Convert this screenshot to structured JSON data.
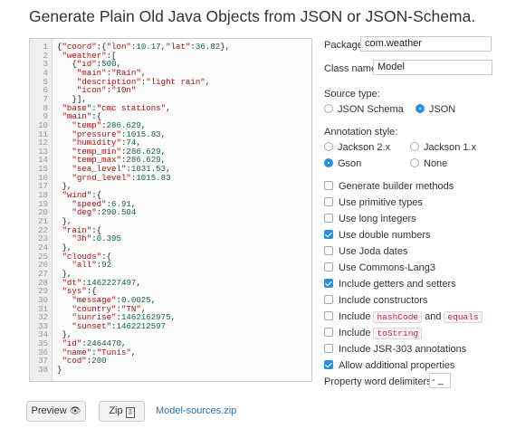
{
  "page": {
    "title": "Generate Plain Old Java Objects from JSON or JSON-Schema."
  },
  "editor": {
    "lines": [
      [
        [
          "p",
          "{"
        ],
        [
          "k",
          "\"coord\""
        ],
        [
          "p",
          ":{"
        ],
        [
          "k",
          "\"lon\""
        ],
        [
          "p",
          ":"
        ],
        [
          "n",
          "10.17"
        ],
        [
          "p",
          ","
        ],
        [
          "k",
          "\"lat\""
        ],
        [
          "p",
          ":"
        ],
        [
          "n",
          "36.82"
        ],
        [
          "p",
          "},"
        ]
      ],
      [
        [
          "p",
          " "
        ],
        [
          "k",
          "\"weather\""
        ],
        [
          "p",
          ":["
        ]
      ],
      [
        [
          "p",
          "   {"
        ],
        [
          "k",
          "\"id\""
        ],
        [
          "p",
          ":"
        ],
        [
          "n",
          "500"
        ],
        [
          "p",
          ","
        ]
      ],
      [
        [
          "p",
          "    "
        ],
        [
          "k",
          "\"main\""
        ],
        [
          "p",
          ":"
        ],
        [
          "s",
          "\"Rain\""
        ],
        [
          "p",
          ","
        ]
      ],
      [
        [
          "p",
          "    "
        ],
        [
          "k",
          "\"description\""
        ],
        [
          "p",
          ":"
        ],
        [
          "s",
          "\"light rain\""
        ],
        [
          "p",
          ","
        ]
      ],
      [
        [
          "p",
          "    "
        ],
        [
          "k",
          "\"icon\""
        ],
        [
          "p",
          ":"
        ],
        [
          "s",
          "\"10n\""
        ]
      ],
      [
        [
          "p",
          "   }],"
        ]
      ],
      [
        [
          "p",
          " "
        ],
        [
          "k",
          "\"base\""
        ],
        [
          "p",
          ":"
        ],
        [
          "s",
          "\"cmc stations\""
        ],
        [
          "p",
          ","
        ]
      ],
      [
        [
          "p",
          " "
        ],
        [
          "k",
          "\"main\""
        ],
        [
          "p",
          ":{"
        ]
      ],
      [
        [
          "p",
          "   "
        ],
        [
          "k",
          "\"temp\""
        ],
        [
          "p",
          ":"
        ],
        [
          "n",
          "286.629"
        ],
        [
          "p",
          ","
        ]
      ],
      [
        [
          "p",
          "   "
        ],
        [
          "k",
          "\"pressure\""
        ],
        [
          "p",
          ":"
        ],
        [
          "n",
          "1015.83"
        ],
        [
          "p",
          ","
        ]
      ],
      [
        [
          "p",
          "   "
        ],
        [
          "k",
          "\"humidity\""
        ],
        [
          "p",
          ":"
        ],
        [
          "n",
          "74"
        ],
        [
          "p",
          ","
        ]
      ],
      [
        [
          "p",
          "   "
        ],
        [
          "k",
          "\"temp_min\""
        ],
        [
          "p",
          ":"
        ],
        [
          "n",
          "286.629"
        ],
        [
          "p",
          ","
        ]
      ],
      [
        [
          "p",
          "   "
        ],
        [
          "k",
          "\"temp_max\""
        ],
        [
          "p",
          ":"
        ],
        [
          "n",
          "286.629"
        ],
        [
          "p",
          ","
        ]
      ],
      [
        [
          "p",
          "   "
        ],
        [
          "k",
          "\"sea_level\""
        ],
        [
          "p",
          ":"
        ],
        [
          "n",
          "1031.53"
        ],
        [
          "p",
          ","
        ]
      ],
      [
        [
          "p",
          "   "
        ],
        [
          "k",
          "\"grnd_level\""
        ],
        [
          "p",
          ":"
        ],
        [
          "n",
          "1015.83"
        ]
      ],
      [
        [
          "p",
          " },"
        ]
      ],
      [
        [
          "p",
          " "
        ],
        [
          "k",
          "\"wind\""
        ],
        [
          "p",
          ":{"
        ]
      ],
      [
        [
          "p",
          "   "
        ],
        [
          "k",
          "\"speed\""
        ],
        [
          "p",
          ":"
        ],
        [
          "n",
          "6.91"
        ],
        [
          "p",
          ","
        ]
      ],
      [
        [
          "p",
          "   "
        ],
        [
          "k",
          "\"deg\""
        ],
        [
          "p",
          ":"
        ],
        [
          "n",
          "290.504"
        ]
      ],
      [
        [
          "p",
          " },"
        ]
      ],
      [
        [
          "p",
          " "
        ],
        [
          "k",
          "\"rain\""
        ],
        [
          "p",
          ":{"
        ]
      ],
      [
        [
          "p",
          "   "
        ],
        [
          "k",
          "\"3h\""
        ],
        [
          "p",
          ":"
        ],
        [
          "n",
          "0.395"
        ]
      ],
      [
        [
          "p",
          " },"
        ]
      ],
      [
        [
          "p",
          " "
        ],
        [
          "k",
          "\"clouds\""
        ],
        [
          "p",
          ":{"
        ]
      ],
      [
        [
          "p",
          "   "
        ],
        [
          "k",
          "\"all\""
        ],
        [
          "p",
          ":"
        ],
        [
          "n",
          "92"
        ]
      ],
      [
        [
          "p",
          " },"
        ]
      ],
      [
        [
          "p",
          " "
        ],
        [
          "k",
          "\"dt\""
        ],
        [
          "p",
          ":"
        ],
        [
          "n",
          "1462227497"
        ],
        [
          "p",
          ","
        ]
      ],
      [
        [
          "p",
          " "
        ],
        [
          "k",
          "\"sys\""
        ],
        [
          "p",
          ":{"
        ]
      ],
      [
        [
          "p",
          "   "
        ],
        [
          "k",
          "\"message\""
        ],
        [
          "p",
          ":"
        ],
        [
          "n",
          "0.0025"
        ],
        [
          "p",
          ","
        ]
      ],
      [
        [
          "p",
          "   "
        ],
        [
          "k",
          "\"country\""
        ],
        [
          "p",
          ":"
        ],
        [
          "s",
          "\"TN\""
        ],
        [
          "p",
          ","
        ]
      ],
      [
        [
          "p",
          "   "
        ],
        [
          "k",
          "\"sunrise\""
        ],
        [
          "p",
          ":"
        ],
        [
          "n",
          "1462162975"
        ],
        [
          "p",
          ","
        ]
      ],
      [
        [
          "p",
          "   "
        ],
        [
          "k",
          "\"sunset\""
        ],
        [
          "p",
          ":"
        ],
        [
          "n",
          "1462212597"
        ]
      ],
      [
        [
          "p",
          " },"
        ]
      ],
      [
        [
          "p",
          " "
        ],
        [
          "k",
          "\"id\""
        ],
        [
          "p",
          ":"
        ],
        [
          "n",
          "2464470"
        ],
        [
          "p",
          ","
        ]
      ],
      [
        [
          "p",
          " "
        ],
        [
          "k",
          "\"name\""
        ],
        [
          "p",
          ":"
        ],
        [
          "s",
          "\"Tunis\""
        ],
        [
          "p",
          ","
        ]
      ],
      [
        [
          "p",
          " "
        ],
        [
          "k",
          "\"cod\""
        ],
        [
          "p",
          ":"
        ],
        [
          "n",
          "200"
        ]
      ],
      [
        [
          "p",
          "}"
        ]
      ]
    ]
  },
  "form": {
    "package_label": "Package",
    "package_value": "com.weather",
    "classname_label": "Class name",
    "classname_value": "Model",
    "source_type_label": "Source type:",
    "source_json_schema": "JSON Schema",
    "source_json": "JSON",
    "annotation_label": "Annotation style:",
    "jackson2": "Jackson 2.x",
    "jackson1": "Jackson 1.x",
    "gson": "Gson",
    "none": "None",
    "opt_builder": "Generate builder methods",
    "opt_primitive": "Use primitive types",
    "opt_long": "Use long integers",
    "opt_double": "Use double numbers",
    "opt_joda": "Use Joda dates",
    "opt_commons": "Use Commons-Lang3",
    "opt_getset": "Include getters and setters",
    "opt_constructors": "Include constructors",
    "opt_hash_prefix": "Include",
    "opt_hash_code1": "hashCode",
    "opt_hash_and": "and",
    "opt_hash_code2": "equals",
    "opt_tostring_prefix": "Include",
    "opt_tostring_code": "toString",
    "opt_jsr303": "Include JSR-303 annotations",
    "opt_additional": "Allow additional properties",
    "delimiters_label": "Property word delimiters:",
    "delimiters_value": "- _"
  },
  "footer": {
    "preview_label": "Preview",
    "preview_icon_glyph": "👁",
    "zip_label": "Zip",
    "zip_icon_glyph": "⇩",
    "download_link": "Model-sources.zip"
  },
  "colors": {
    "accent": "#2a8fe0",
    "link": "#2a6fb4"
  }
}
